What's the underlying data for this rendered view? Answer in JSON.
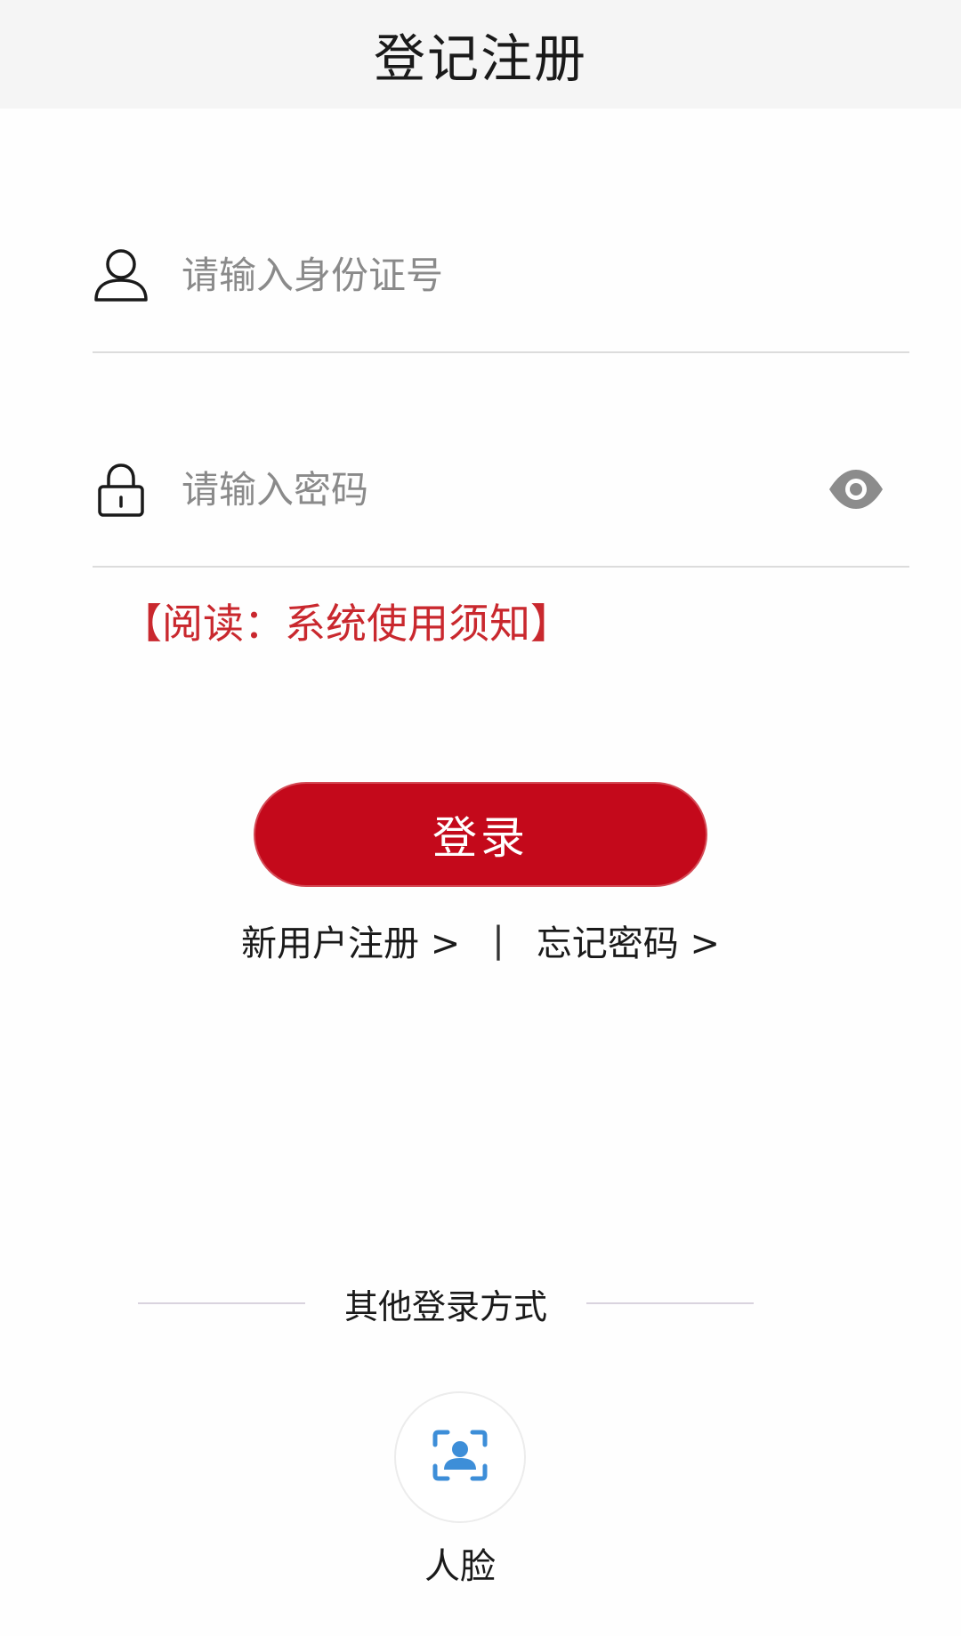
{
  "header": {
    "title": "登记注册"
  },
  "form": {
    "id_field": {
      "placeholder": "请输入身份证号",
      "value": "",
      "icon": "user-icon"
    },
    "password_field": {
      "placeholder": "请输入密码",
      "value": "",
      "icon": "lock-icon",
      "toggle_icon": "eye-icon"
    },
    "notice_link": "【阅读：系统使用须知】"
  },
  "actions": {
    "login_label": "登录",
    "register_link": "新用户注册 >",
    "separator": "|",
    "forgot_link": "忘记密码 >"
  },
  "other_login": {
    "title": "其他登录方式",
    "options": [
      {
        "label": "人脸",
        "icon": "face-scan-icon"
      }
    ]
  },
  "colors": {
    "accent": "#c4091b",
    "notice": "#c9282e",
    "face_icon": "#3d8ed8"
  }
}
